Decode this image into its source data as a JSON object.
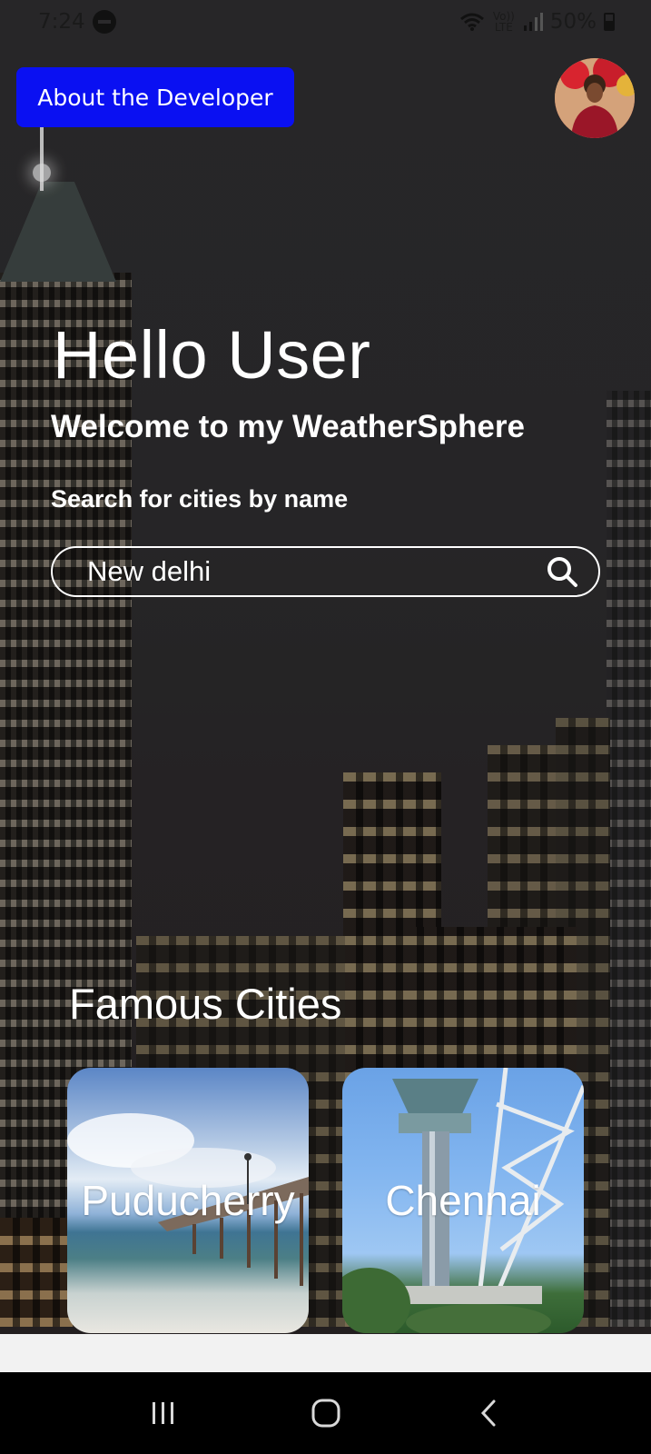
{
  "status_bar": {
    "time": "7:24",
    "volte": "Vo)) LTE",
    "battery": "50%"
  },
  "header": {
    "about_label": "About the Developer"
  },
  "hero": {
    "greeting": "Hello User",
    "welcome": "Welcome to my WeatherSphere",
    "search_label": "Search for cities by name"
  },
  "search": {
    "value": "New delhi",
    "placeholder": "New delhi"
  },
  "famous": {
    "title": "Famous Cities",
    "cities": [
      {
        "name": "Puducherry"
      },
      {
        "name": "Chennai"
      }
    ]
  },
  "colors": {
    "about_button": "#0a10f2",
    "background": "#2b2a2c",
    "text": "#ffffff"
  },
  "icons": {
    "search": "search-icon",
    "recents": "recents-icon",
    "home": "home-icon",
    "back": "back-icon"
  }
}
